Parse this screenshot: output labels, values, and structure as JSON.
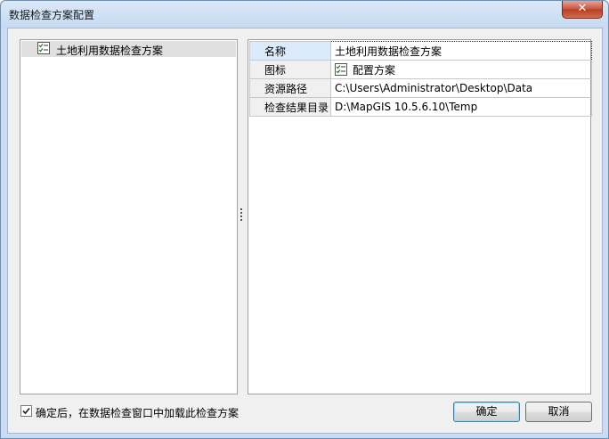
{
  "window": {
    "title": "数据检查方案配置",
    "close_glyph": "✕"
  },
  "tree": {
    "items": [
      {
        "label": "土地利用数据检查方案",
        "icon": "checklist-icon"
      }
    ]
  },
  "properties": {
    "rows": [
      {
        "name": "名称",
        "value": "土地利用数据检查方案"
      },
      {
        "name": "图标",
        "value": "配置方案",
        "icon": "checklist-icon"
      },
      {
        "name": "资源路径",
        "value": "C:\\Users\\Administrator\\Desktop\\Data"
      },
      {
        "name": "检查结果目录",
        "value": "D:\\MapGIS 10.5.6.10\\Temp"
      }
    ]
  },
  "footer": {
    "checkbox_label": "确定后，在数据检查窗口中加载此检查方案",
    "checkbox_checked": true,
    "ok_label": "确定",
    "cancel_label": "取消"
  },
  "colors": {
    "titlebar": "#c6daf1",
    "close_button": "#c7533e",
    "selected_row": "#dcebfb"
  }
}
